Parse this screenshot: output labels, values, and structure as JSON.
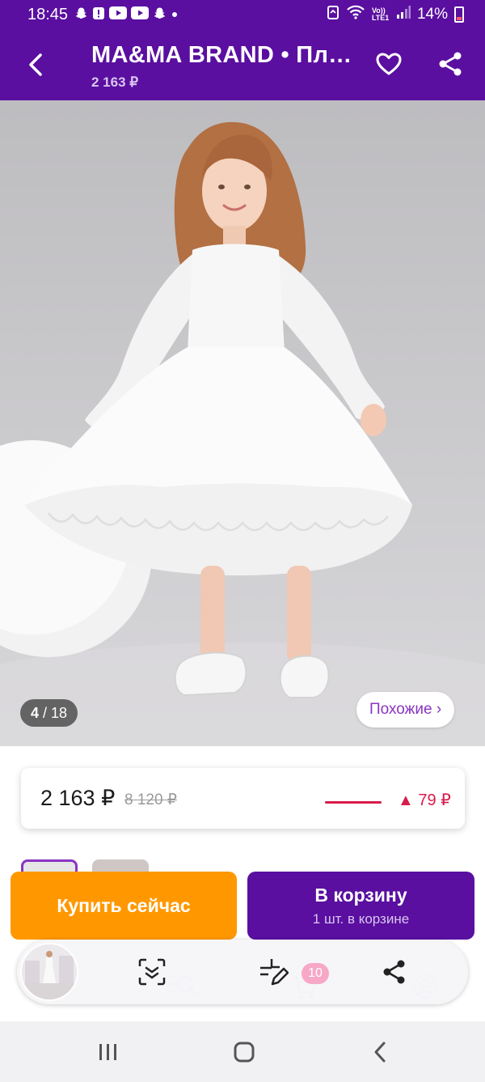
{
  "status_bar": {
    "time": "18:45",
    "network": "Vo)) LTE1",
    "battery": "14%",
    "notification_icons": [
      "snapchat-icon",
      "alert-icon",
      "youtube-icon",
      "youtube-icon",
      "snapchat-icon",
      "dot-icon"
    ]
  },
  "header": {
    "title": "MA&MA BRAND • Пл…",
    "price": "2 163 ₽"
  },
  "gallery": {
    "counter_current": "4",
    "counter_total": "/ 18",
    "similar_label": "Похожие ›"
  },
  "price_card": {
    "current": "2 163 ₽",
    "old": "8 120 ₽",
    "delta": "▲ 79 ₽"
  },
  "actions": {
    "buy_now": "Купить сейчас",
    "to_cart": "В корзину",
    "in_cart": "1 шт. в корзине"
  },
  "toolbar": {
    "cart_badge": "10"
  },
  "colors": {
    "brand": "#5a0fa0",
    "buy": "#ff9800",
    "accent": "#8a35c4",
    "alert": "#d81b4b"
  }
}
